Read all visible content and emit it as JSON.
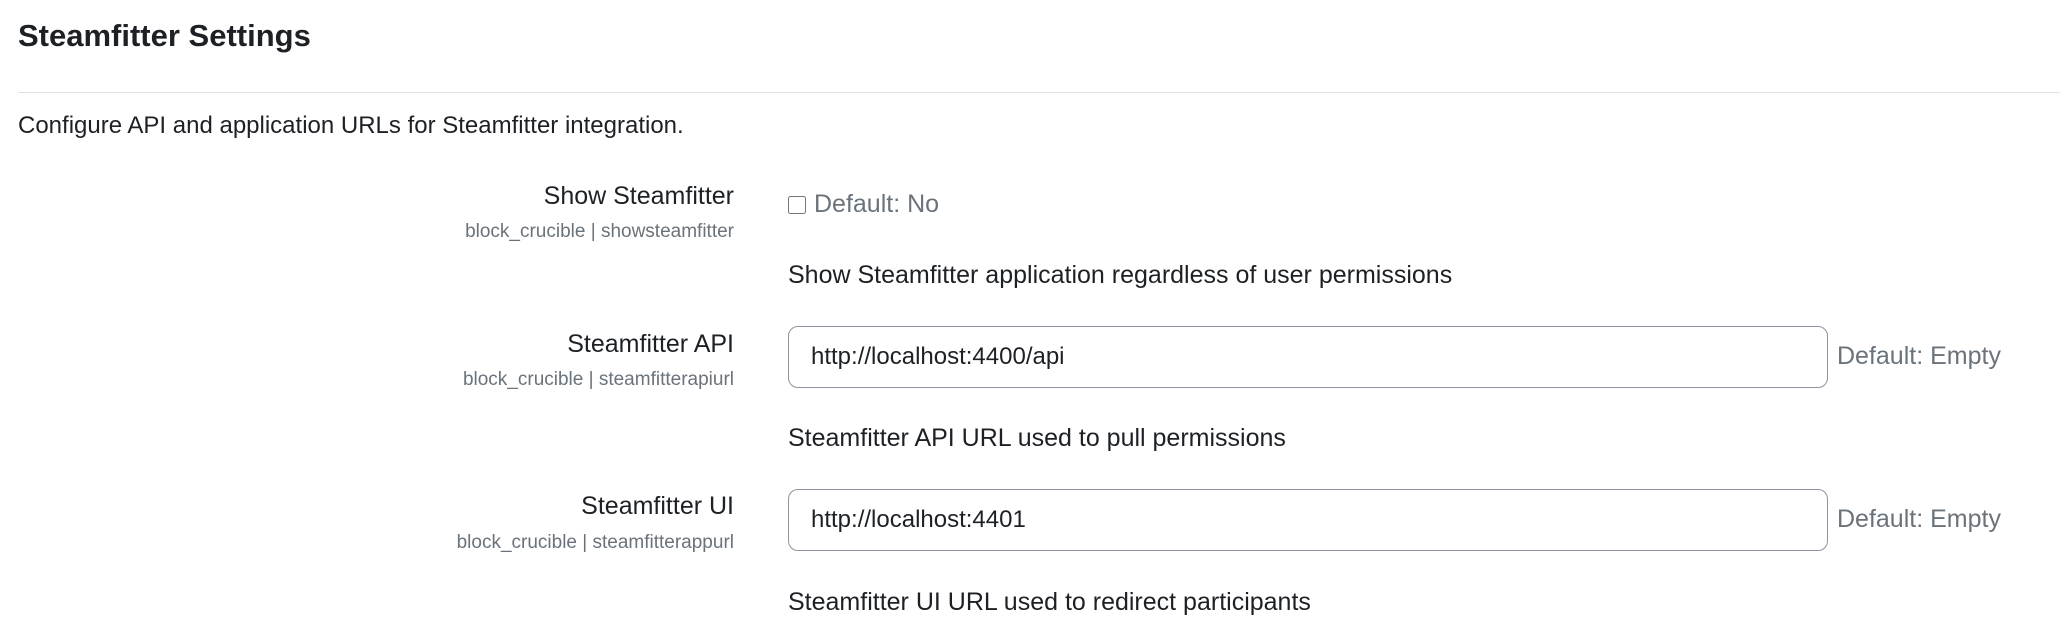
{
  "section": {
    "title": "Steamfitter Settings",
    "description": "Configure API and application URLs for Steamfitter integration."
  },
  "settings": [
    {
      "label": "Show Steamfitter",
      "identifier": "block_crucible | showsteamfitter",
      "type": "checkbox",
      "checked": false,
      "default": "Default: No",
      "description": "Show Steamfitter application regardless of user permissions"
    },
    {
      "label": "Steamfitter API",
      "identifier": "block_crucible | steamfitterapiurl",
      "type": "text",
      "value": "http://localhost:4400/api",
      "default": "Default: Empty",
      "description": "Steamfitter API URL used to pull permissions"
    },
    {
      "label": "Steamfitter UI",
      "identifier": "block_crucible | steamfitterappurl",
      "type": "text",
      "value": "http://localhost:4401",
      "default": "Default: Empty",
      "description": "Steamfitter UI URL used to redirect participants"
    }
  ]
}
